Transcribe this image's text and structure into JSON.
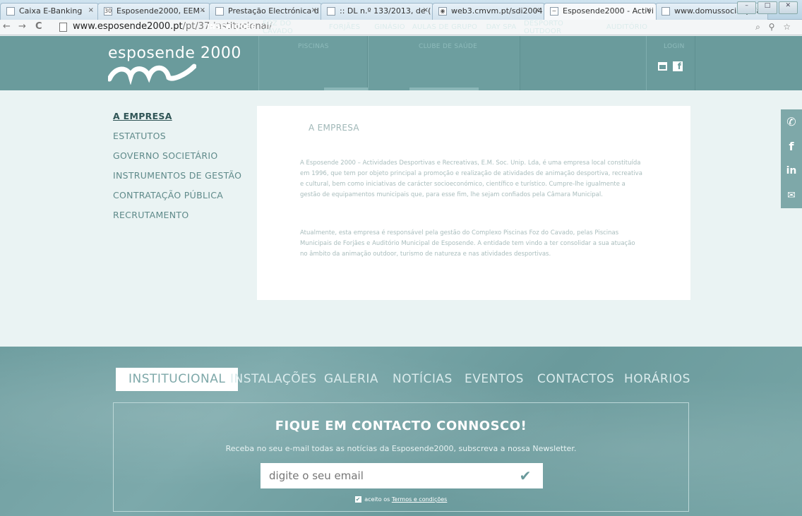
{
  "browser": {
    "tabs": [
      {
        "label": "Caixa E-Banking"
      },
      {
        "label": "Esposende2000, EEM -"
      },
      {
        "label": "Prestação Electrónica d"
      },
      {
        "label": ":: DL n.º 133/2013, de ("
      },
      {
        "label": "web3.cmvm.pt/sdi2004"
      },
      {
        "label": "Esposende2000 - Activi"
      },
      {
        "label": "www.domussocial.pt/a"
      }
    ],
    "url_host": "www.esposende2000.pt",
    "url_path": "/pt/37-institucional/"
  },
  "header": {
    "logo": "esposende 2000",
    "inscricoes": "INSCRIÇÕES",
    "group_piscinas": "PISCINAS",
    "group_clube": "CLUBE DE SAÚDE",
    "group_login": "LOGIN",
    "nav": [
      "FOZ DO CÁVADO",
      "FORJÃES",
      "GINÁSIO",
      "AULAS DE GRUPO",
      "DAY SPA",
      "DESPORTO OUTDOOR",
      "AUDITÓRIO"
    ]
  },
  "sidebar": {
    "items": [
      "A EMPRESA",
      "ESTATUTOS",
      "GOVERNO SOCIETÁRIO",
      "INSTRUMENTOS DE GESTÃO",
      "CONTRATAÇÃO PÚBLICA",
      "RECRUTAMENTO"
    ]
  },
  "content": {
    "title": "A EMPRESA",
    "p1": "A Esposende 2000 – Actividades Desportivas e Recreativas, E.M. Soc. Unip. Lda, é uma empresa local constituída em 1996, que tem por objeto principal a promoção e realização de atividades de animação desportiva, recreativa e cultural, bem como iniciativas de carácter socioeconómico, científico e turístico. Cumpre-lhe igualmente a gestão de equipamentos municipais que, para esse fim, lhe sejam confiados pela Câmara Municipal.",
    "p2": "Atualmente, esta empresa é responsável pela gestão do Complexo Piscinas Foz do Cavado, pelas Piscinas Municipais de Forjães e Auditório Municipal de Esposende. A entidade tem vindo a ter consolidar a sua atuação no âmbito da animação outdoor, turismo de natureza e nas atividades desportivas."
  },
  "footer": {
    "nav": [
      "INSTITUCIONAL",
      "INSTALAÇÕES",
      "GALERIA",
      "NOTÍCIAS",
      "EVENTOS",
      "CONTACTOS",
      "HORÁRIOS"
    ],
    "newsletter_title": "FIQUE EM CONTACTO CONNOSCO!",
    "newsletter_sub": "Receba no seu e-mail todas as notícias da Esposende2000, subscreva a nossa Newsletter.",
    "email_placeholder": "digite o seu email",
    "terms_prefix": "aceito os",
    "terms_link": "Termos e condições"
  }
}
